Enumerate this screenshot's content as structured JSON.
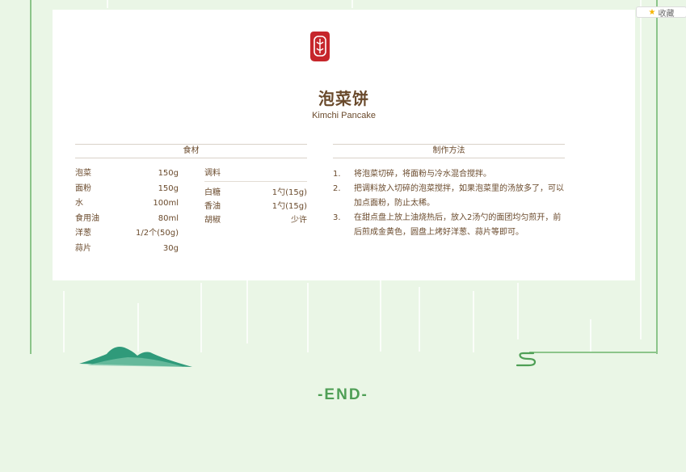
{
  "toolbar": {
    "fav_label": "收藏",
    "fav_icon": "star-icon"
  },
  "recipe": {
    "title": "泡菜饼",
    "subtitle": "Kimchi Pancake",
    "ingredients_heading": "食材",
    "method_heading": "制作方法",
    "main_ingredients": [
      {
        "name": "泡菜",
        "qty": "150g"
      },
      {
        "name": "面粉",
        "qty": "150g"
      },
      {
        "name": "水",
        "qty": "100ml"
      },
      {
        "name": "食用油",
        "qty": "80ml"
      },
      {
        "name": "洋葱",
        "qty": "1/2个(50g)"
      },
      {
        "name": "蒜片",
        "qty": "30g"
      }
    ],
    "seasoning": {
      "title": "调料",
      "items": [
        {
          "name": "白糖",
          "qty": "1勺(15g)"
        },
        {
          "name": "香油",
          "qty": "1勺(15g)"
        },
        {
          "name": "胡椒",
          "qty": "少许"
        }
      ]
    },
    "steps": [
      {
        "num": "1.",
        "text": "将泡菜切碎，将面粉与冷水混合搅拌。"
      },
      {
        "num": "2.",
        "text": "把调料放入切碎的泡菜搅拌，如果泡菜里的汤放多了，可以加点面粉，防止太稀。"
      },
      {
        "num": "3.",
        "text": "在甜点盘上放上油烧热后，放入2汤勺的面团均匀煎开，前后煎成金黄色，圆盘上烤好洋葱、蒜片等即可。"
      }
    ]
  },
  "footer": {
    "end_label": "-END-"
  },
  "colors": {
    "accent_green": "#4f9f56",
    "text_brown": "#6a4a2c",
    "logo_red": "#c6262b"
  }
}
